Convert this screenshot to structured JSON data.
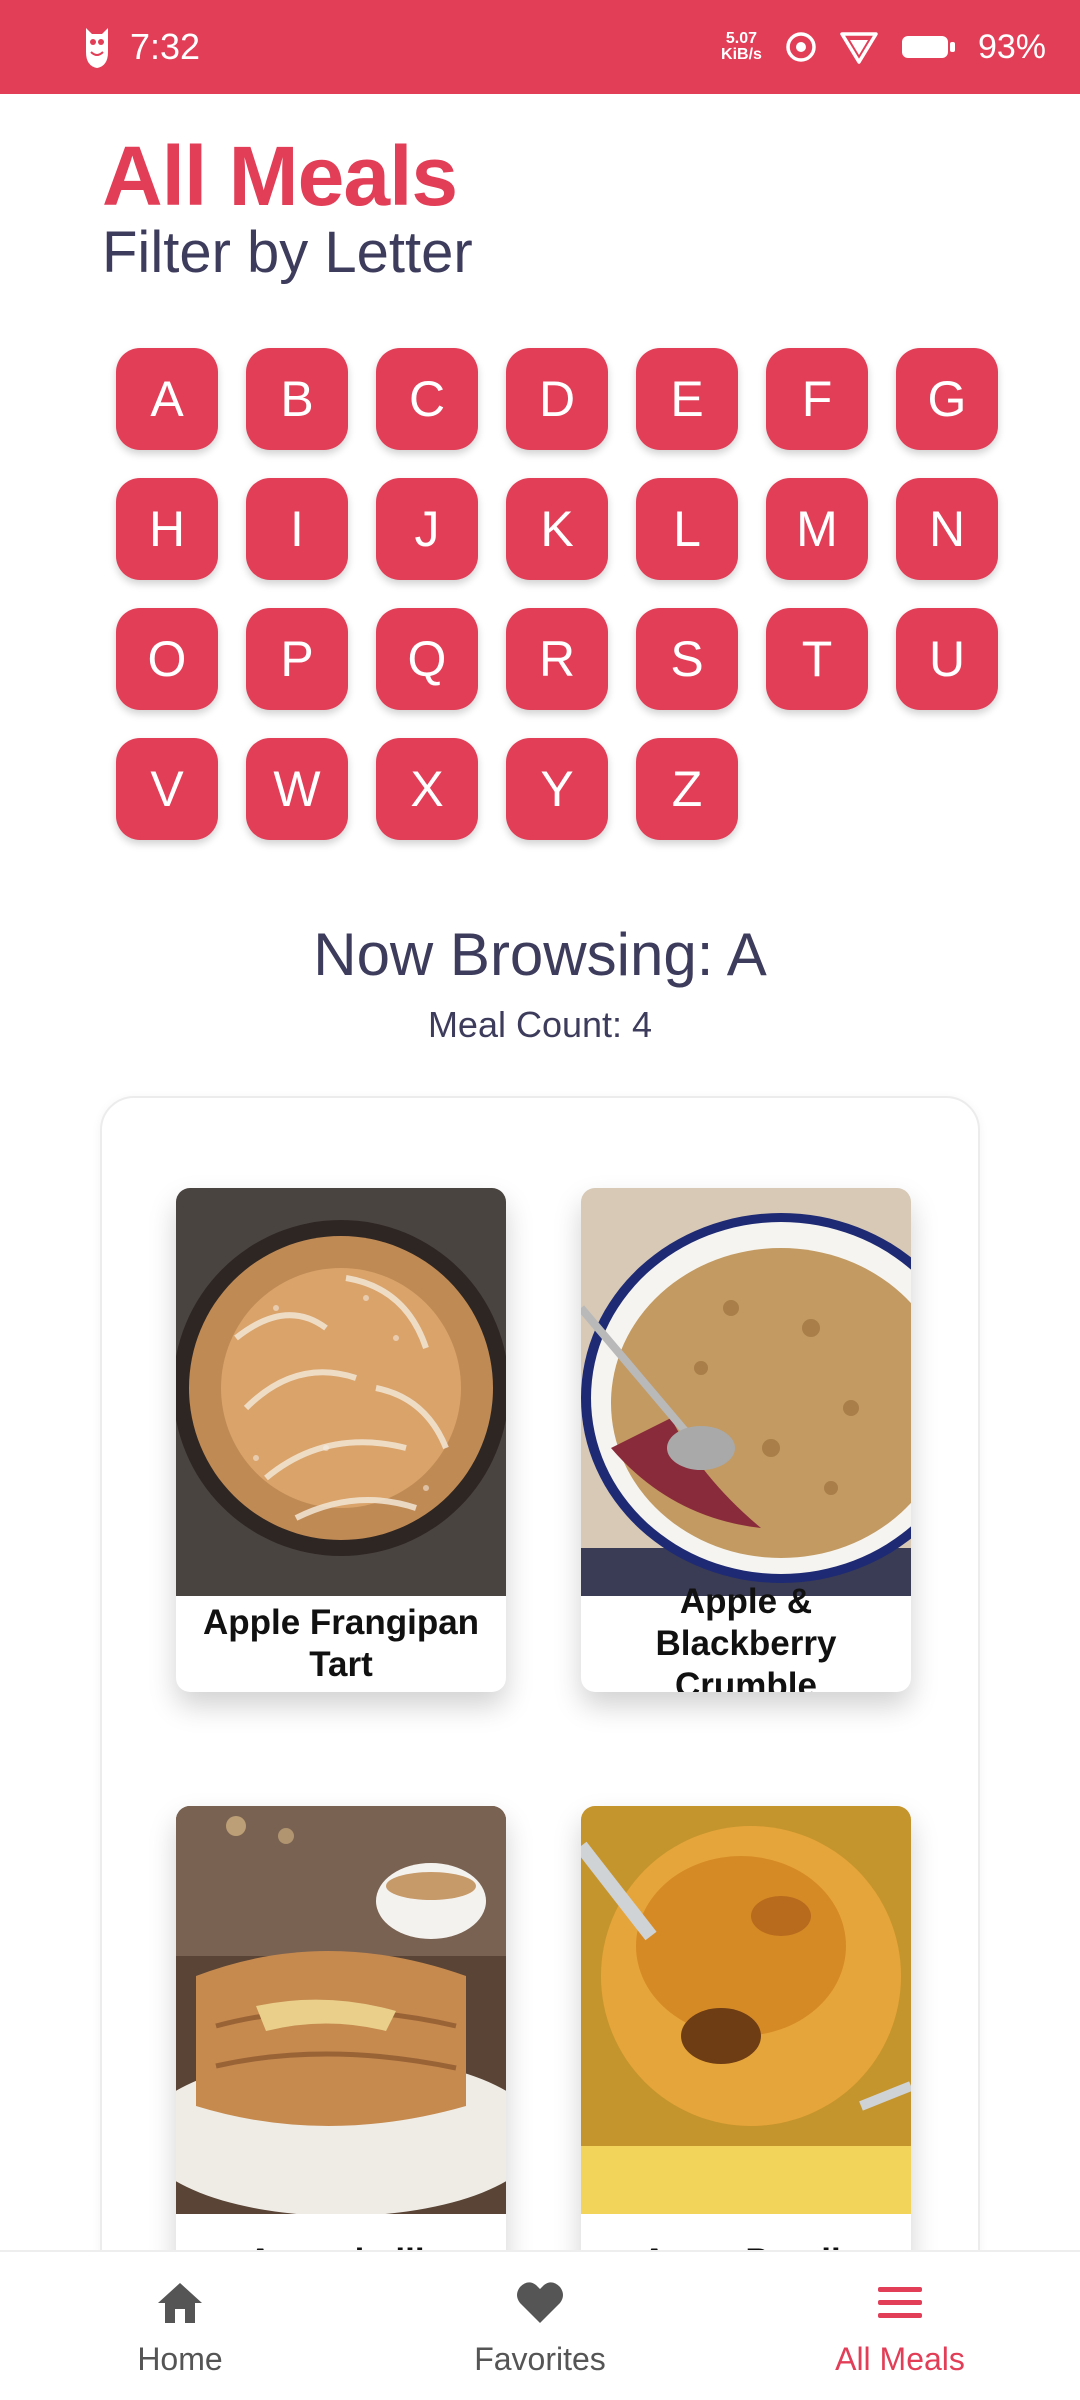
{
  "status_bar": {
    "time": "7:32",
    "net_speed_value": "5.07",
    "net_speed_unit": "KiB/s",
    "battery": "93%"
  },
  "header": {
    "title": "All Meals",
    "subtitle": "Filter by Letter"
  },
  "letters": [
    "A",
    "B",
    "C",
    "D",
    "E",
    "F",
    "G",
    "H",
    "I",
    "J",
    "K",
    "L",
    "M",
    "N",
    "O",
    "P",
    "Q",
    "R",
    "S",
    "T",
    "U",
    "V",
    "W",
    "X",
    "Y",
    "Z"
  ],
  "browsing": {
    "now_browsing": "Now Browsing: A",
    "meal_count": "Meal Count: 4"
  },
  "meals": [
    {
      "name": "Apple Frangipan Tart"
    },
    {
      "name": "Apple & Blackberry Crumble"
    },
    {
      "name": "Apam balik"
    },
    {
      "name": "Ayam Percik"
    }
  ],
  "bottom_nav": {
    "items": [
      {
        "label": "Home",
        "icon": "home-icon"
      },
      {
        "label": "Favorites",
        "icon": "heart-icon"
      },
      {
        "label": "All Meals",
        "icon": "menu-icon",
        "active": true
      }
    ]
  },
  "colors": {
    "accent": "#e23e57",
    "heading": "#3d3c5c"
  }
}
